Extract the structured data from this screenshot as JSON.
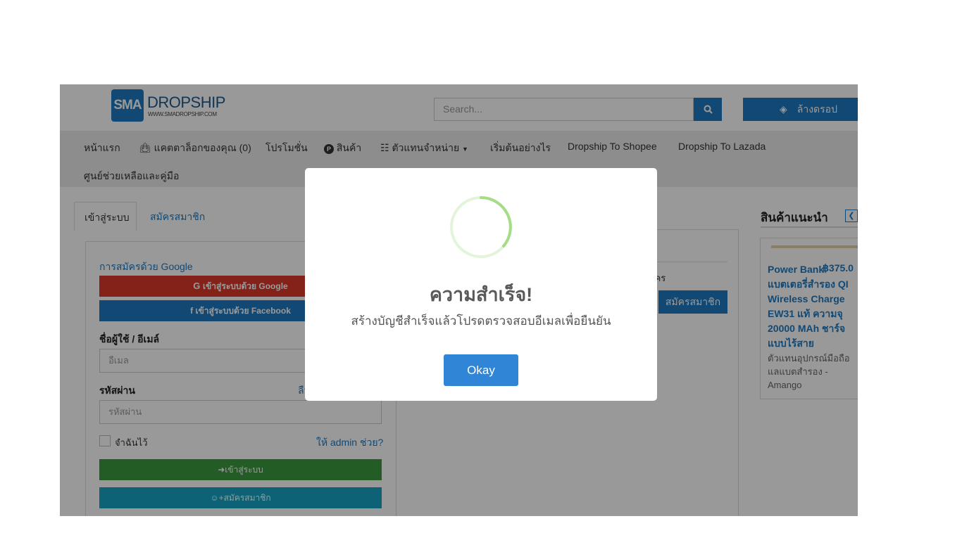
{
  "header": {
    "logo_abbr": "SMA",
    "logo_word": "DROPSHIP",
    "logo_url": "WWW.SMADROPSHIP.COM",
    "search_placeholder": "Search...",
    "cart_label": "ล้างดรอป"
  },
  "nav": {
    "items": [
      {
        "label": "หน้าแรก"
      },
      {
        "label": "แคตตาล็อกของคุณ (0)"
      },
      {
        "label": "โปรโมชั่น"
      },
      {
        "label": "สินค้า"
      },
      {
        "label": "ตัวแทนจำหน่าย"
      },
      {
        "label": "เริ่มต้นอย่างไร"
      },
      {
        "label": "Dropship To Shopee"
      },
      {
        "label": "Dropship To Lazada"
      },
      {
        "label": "ศูนย์ช่วยเหลือและคู่มือ"
      }
    ]
  },
  "login": {
    "tab_login": "เข้าสู่ระบบ",
    "tab_register": "สมัครสมาชิก",
    "google_label": "การสมัครด้วย Google",
    "google_button": "เข้าสู่ระบบด้วย Google",
    "facebook_button": "เข้าสู่ระบบด้วย Facebook",
    "username_label": "ชื่อผู้ใช้ / อีเมล์",
    "username_placeholder": "อีเมล",
    "password_label": "รหัสผ่าน",
    "forgot_label": "ลืม",
    "password_placeholder": "รหัสผ่าน",
    "remember_label": "จำฉันไว้",
    "admin_help": "ให้ admin ช่วย?",
    "login_button": "เข้าสู่ระบบ",
    "signup_button": "สมัครสมาชิก"
  },
  "register_panel": {
    "text_fragment": "มัคร",
    "button": "สมัครสมาชิก"
  },
  "sidebar": {
    "title": "สินค้าแนะนำ",
    "product_name": "Power Bank แบตเตอรี่สำรอง QI Wireless Charge EW31 แท้ ความจุ 20000 MAh ชาร์จแบบไร้สาย",
    "product_price": "฿375.0",
    "product_seller": "ตัวแทนอุปกรณ์มือถือ แลแบตสำรอง - Amango"
  },
  "modal": {
    "title": "ความสำเร็จ!",
    "message": "สร้างบัญชีสำเร็จแล้วโปรดตรวจสอบอีเมลเพื่อยืนยัน",
    "button": "Okay"
  },
  "colors": {
    "primary": "#1f7bc1",
    "google": "#dd3a2c",
    "login_green": "#3d9a3f",
    "signup_cyan": "#17a3c4",
    "modal_button": "#3085d6",
    "spinner": "#a5dc86"
  }
}
